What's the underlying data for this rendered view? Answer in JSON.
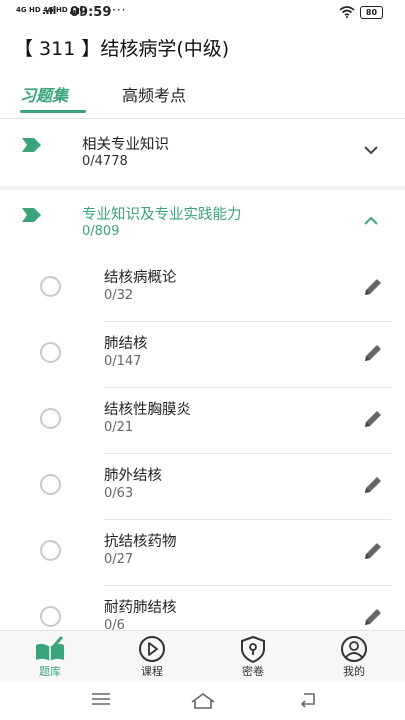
{
  "status_bar": {
    "sim1": "4G HD",
    "sim2": "4G HD",
    "time": "09:59",
    "more": "···",
    "battery": "80"
  },
  "header": {
    "title": "【 311 】结核病学(中级)"
  },
  "tabs": [
    {
      "label": "习题集",
      "active": true
    },
    {
      "label": "高频考点",
      "active": false
    }
  ],
  "sections": [
    {
      "title": "相关专业知识",
      "count": "0/4778",
      "expanded": false
    },
    {
      "title": "专业知识及专业实践能力",
      "count": "0/809",
      "expanded": true
    }
  ],
  "chapters": [
    {
      "name": "结核病概论",
      "count": "0/32"
    },
    {
      "name": "肺结核",
      "count": "0/147"
    },
    {
      "name": "结核性胸膜炎",
      "count": "0/21"
    },
    {
      "name": "肺外结核",
      "count": "0/63"
    },
    {
      "name": "抗结核药物",
      "count": "0/27"
    },
    {
      "name": "耐药肺结核",
      "count": "0/6"
    }
  ],
  "bottom_nav": [
    {
      "label": "题库",
      "icon": "book-icon",
      "active": true
    },
    {
      "label": "课程",
      "icon": "play-icon",
      "active": false
    },
    {
      "label": "密卷",
      "icon": "lock-shield-icon",
      "active": false
    },
    {
      "label": "我的",
      "icon": "user-icon",
      "active": false
    }
  ],
  "colors": {
    "accent": "#3aa57a",
    "text": "#222222",
    "muted": "#666666",
    "radio": "#c9c9c9"
  }
}
